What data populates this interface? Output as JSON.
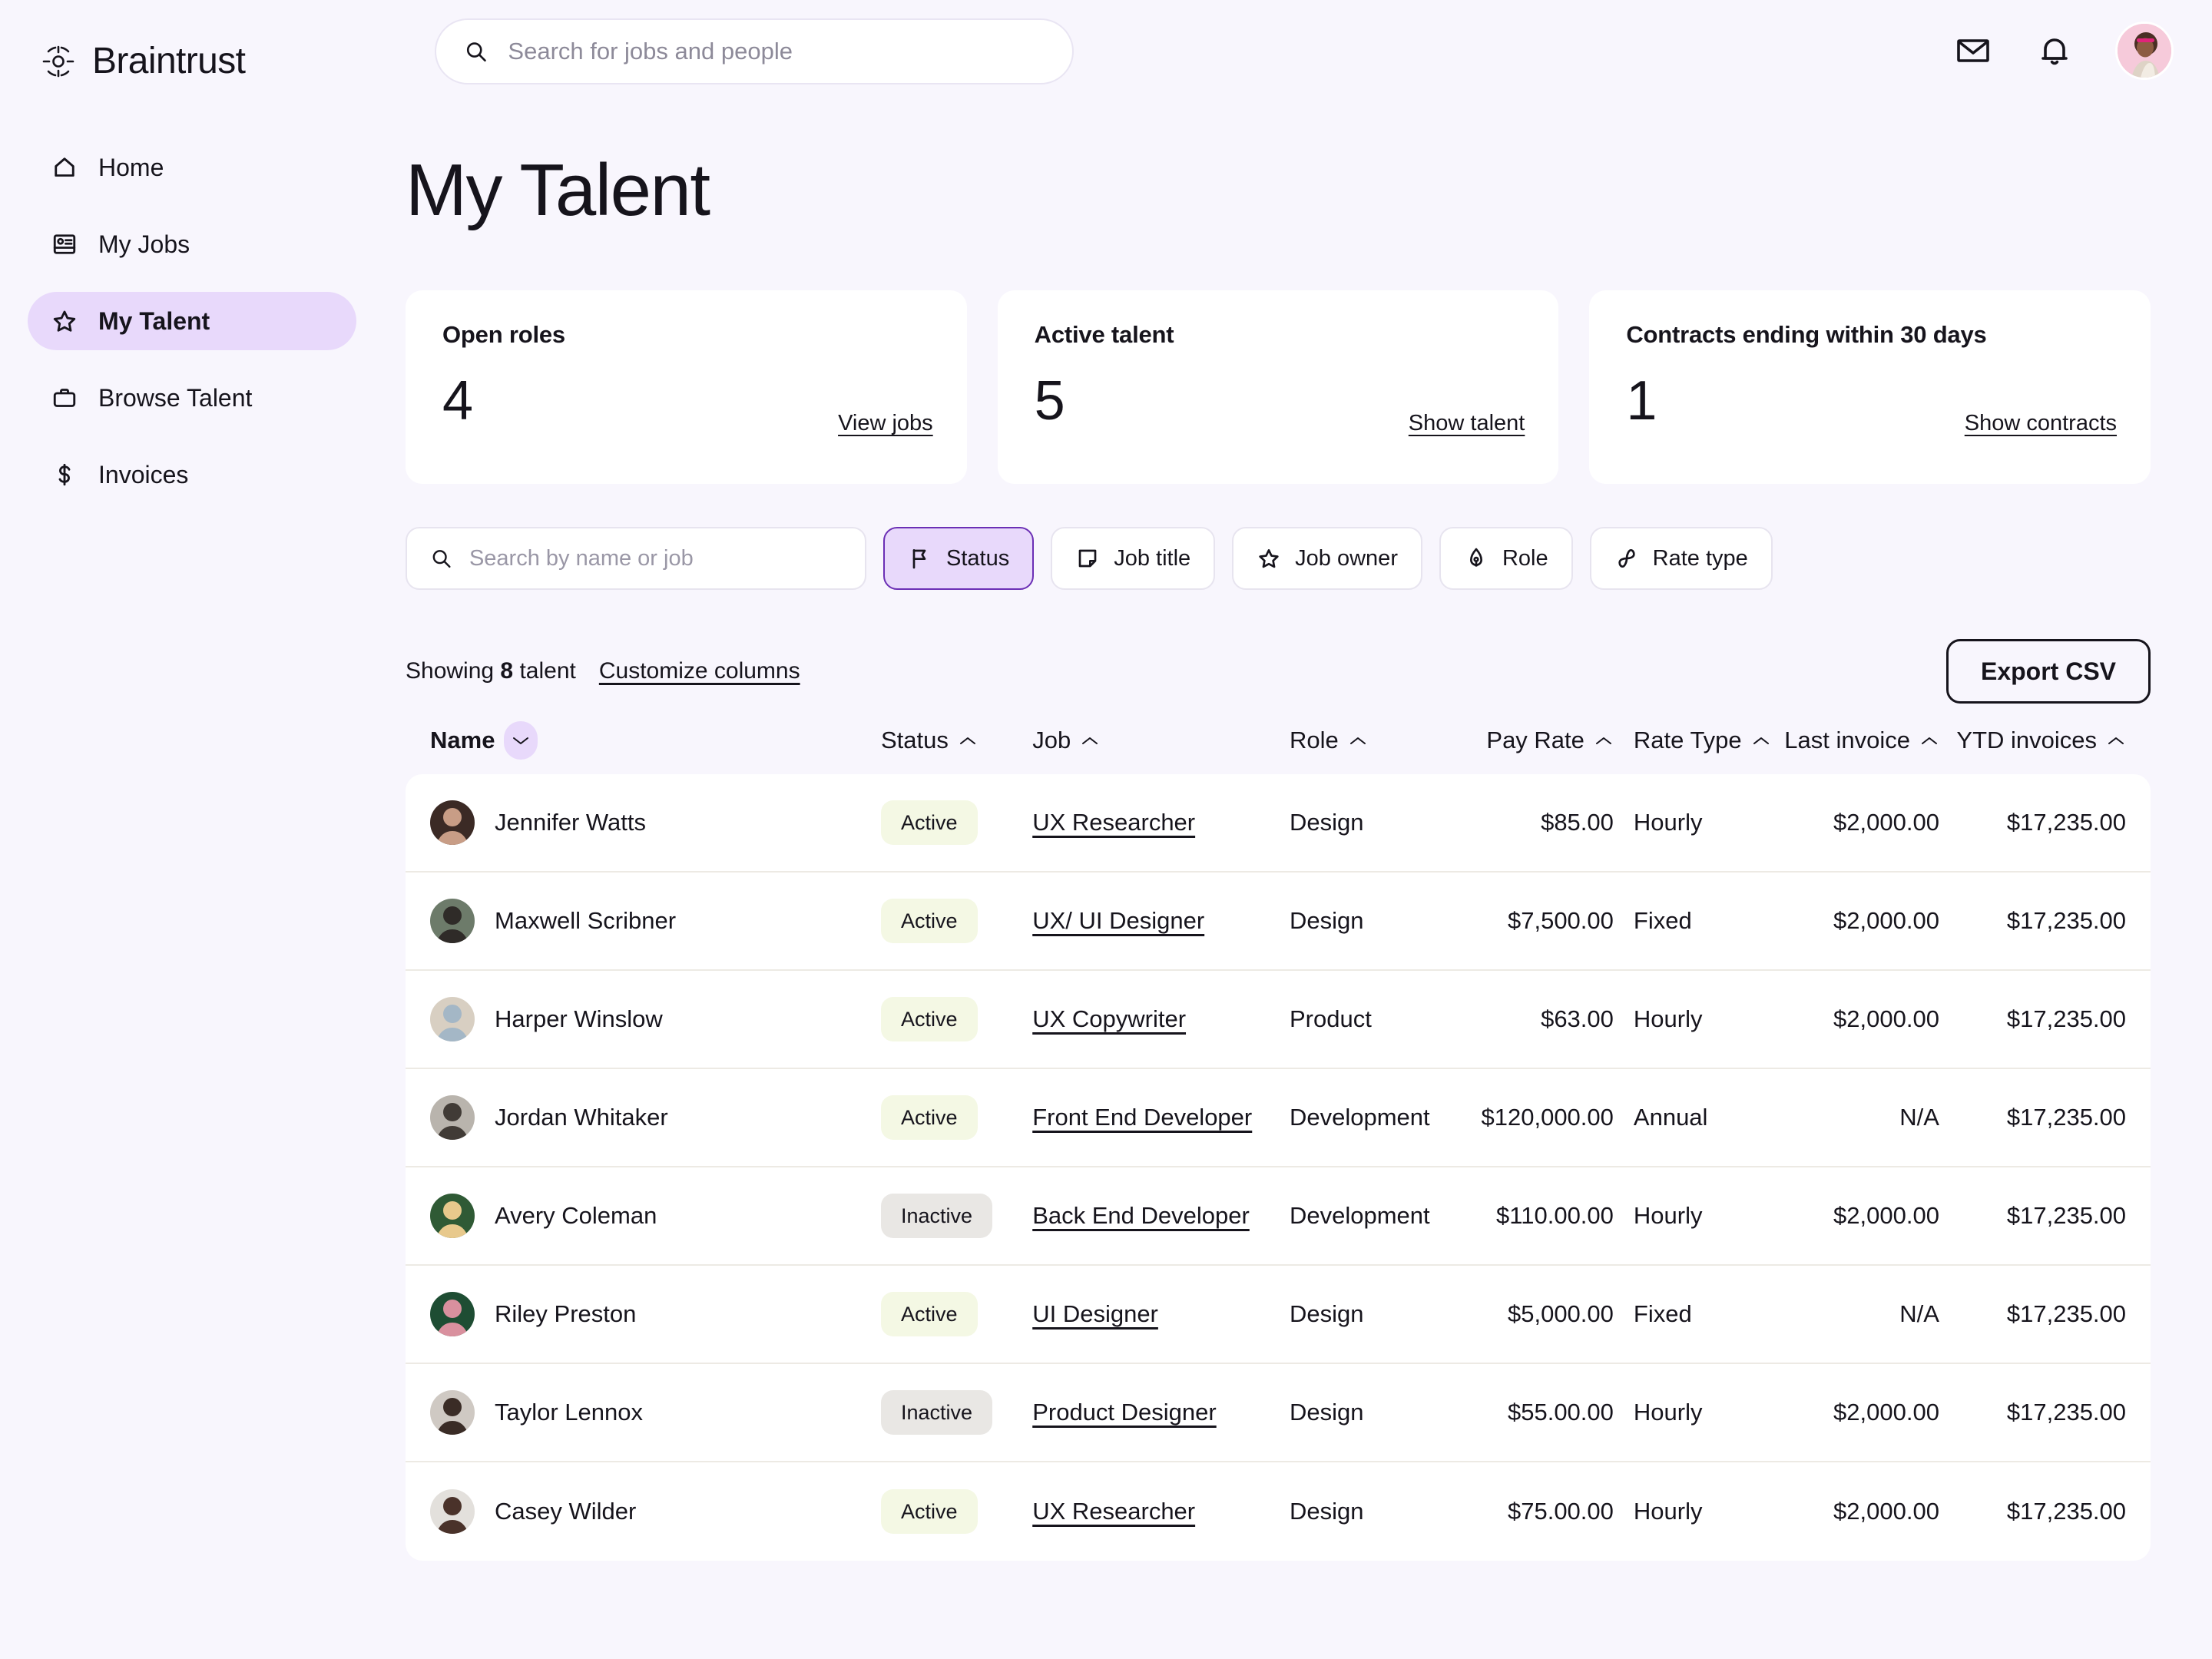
{
  "brand": {
    "name": "Braintrust"
  },
  "search": {
    "placeholder": "Search for jobs and people",
    "value": ""
  },
  "topbar": {
    "mail_icon": "envelope-icon",
    "bell_icon": "bell-icon",
    "avatar": "user-avatar"
  },
  "sidebar": {
    "items": [
      {
        "label": "Home",
        "icon": "home-icon",
        "active": false
      },
      {
        "label": "My Jobs",
        "icon": "id-card-icon",
        "active": false
      },
      {
        "label": "My Talent",
        "icon": "star-icon",
        "active": true
      },
      {
        "label": "Browse Talent",
        "icon": "briefcase-icon",
        "active": false
      },
      {
        "label": "Invoices",
        "icon": "dollar-icon",
        "active": false
      }
    ]
  },
  "page": {
    "title": "My Talent"
  },
  "stats": [
    {
      "title": "Open roles",
      "value": "4",
      "link": "View jobs"
    },
    {
      "title": "Active talent",
      "value": "5",
      "link": "Show talent"
    },
    {
      "title": "Contracts ending within 30 days",
      "value": "1",
      "link": "Show contracts"
    }
  ],
  "filters": {
    "search_placeholder": "Search by name or job",
    "search_value": "",
    "chips": [
      {
        "label": "Status",
        "icon": "flag-icon",
        "selected": true
      },
      {
        "label": "Job title",
        "icon": "note-icon",
        "selected": false
      },
      {
        "label": "Job owner",
        "icon": "star-icon",
        "selected": false
      },
      {
        "label": "Role",
        "icon": "pen-nib-icon",
        "selected": false
      },
      {
        "label": "Rate type",
        "icon": "infinity-icon",
        "selected": false
      }
    ]
  },
  "meta": {
    "showing_prefix": "Showing ",
    "showing_count": "8",
    "showing_suffix": " talent",
    "customize_label": "Customize columns",
    "export_label": "Export CSV"
  },
  "table": {
    "columns": [
      {
        "key": "name",
        "label": "Name",
        "sort": "down"
      },
      {
        "key": "status",
        "label": "Status",
        "sort": "up"
      },
      {
        "key": "job",
        "label": "Job",
        "sort": "up"
      },
      {
        "key": "role",
        "label": "Role",
        "sort": "up"
      },
      {
        "key": "pay",
        "label": "Pay Rate",
        "sort": "up"
      },
      {
        "key": "rtype",
        "label": "Rate Type",
        "sort": "up"
      },
      {
        "key": "last",
        "label": "Last invoice",
        "sort": "up"
      },
      {
        "key": "ytd",
        "label": "YTD invoices",
        "sort": "up"
      }
    ],
    "rows": [
      {
        "name": "Jennifer Watts",
        "status": "Active",
        "job": "UX Researcher",
        "role": "Design",
        "pay": "$85.00",
        "rate_type": "Hourly",
        "last_invoice": "$2,000.00",
        "ytd_invoices": "$17,235.00",
        "avatar_colors": [
          "#3b2a25",
          "#c89d86"
        ]
      },
      {
        "name": "Maxwell Scribner",
        "status": "Active",
        "job": "UX/ UI Designer",
        "role": "Design",
        "pay": "$7,500.00",
        "rate_type": "Fixed",
        "last_invoice": "$2,000.00",
        "ytd_invoices": "$17,235.00",
        "avatar_colors": [
          "#6d7b6a",
          "#2f2b28"
        ]
      },
      {
        "name": "Harper Winslow",
        "status": "Active",
        "job": "UX Copywriter",
        "role": "Product",
        "pay": "$63.00",
        "rate_type": "Hourly",
        "last_invoice": "$2,000.00",
        "ytd_invoices": "$17,235.00",
        "avatar_colors": [
          "#d8cfc2",
          "#a4b7c6"
        ]
      },
      {
        "name": "Jordan Whitaker",
        "status": "Active",
        "job": "Front End Developer",
        "role": "Development",
        "pay": "$120,000.00",
        "rate_type": "Annual",
        "last_invoice": "N/A",
        "ytd_invoices": "$17,235.00",
        "avatar_colors": [
          "#b9b4ad",
          "#413b36"
        ]
      },
      {
        "name": "Avery Coleman",
        "status": "Inactive",
        "job": "Back End Developer",
        "role": "Development",
        "pay": "$110.00.00",
        "rate_type": "Hourly",
        "last_invoice": "$2,000.00",
        "ytd_invoices": "$17,235.00",
        "avatar_colors": [
          "#2f5a35",
          "#e8c98c"
        ]
      },
      {
        "name": "Riley Preston",
        "status": "Active",
        "job": "UI Designer",
        "role": "Design",
        "pay": "$5,000.00",
        "rate_type": "Fixed",
        "last_invoice": "N/A",
        "ytd_invoices": "$17,235.00",
        "avatar_colors": [
          "#1e4d33",
          "#d9909e"
        ]
      },
      {
        "name": "Taylor Lennox",
        "status": "Inactive",
        "job": "Product Designer",
        "role": "Design",
        "pay": "$55.00.00",
        "rate_type": "Hourly",
        "last_invoice": "$2,000.00",
        "ytd_invoices": "$17,235.00",
        "avatar_colors": [
          "#cfc9c3",
          "#3a2c26"
        ]
      },
      {
        "name": "Casey Wilder",
        "status": "Active",
        "job": "UX Researcher",
        "role": "Design",
        "pay": "$75.00.00",
        "rate_type": "Hourly",
        "last_invoice": "$2,000.00",
        "ytd_invoices": "$17,235.00",
        "avatar_colors": [
          "#e3e0dc",
          "#4a322a"
        ]
      }
    ]
  },
  "colors": {
    "page_bg": "#f8f6fd",
    "accent": "#6b2fb5",
    "accent_soft": "#e8d9fb",
    "badge_active": "#f4f8e4",
    "badge_inactive": "#e9e7e4",
    "card": "#ffffff"
  }
}
